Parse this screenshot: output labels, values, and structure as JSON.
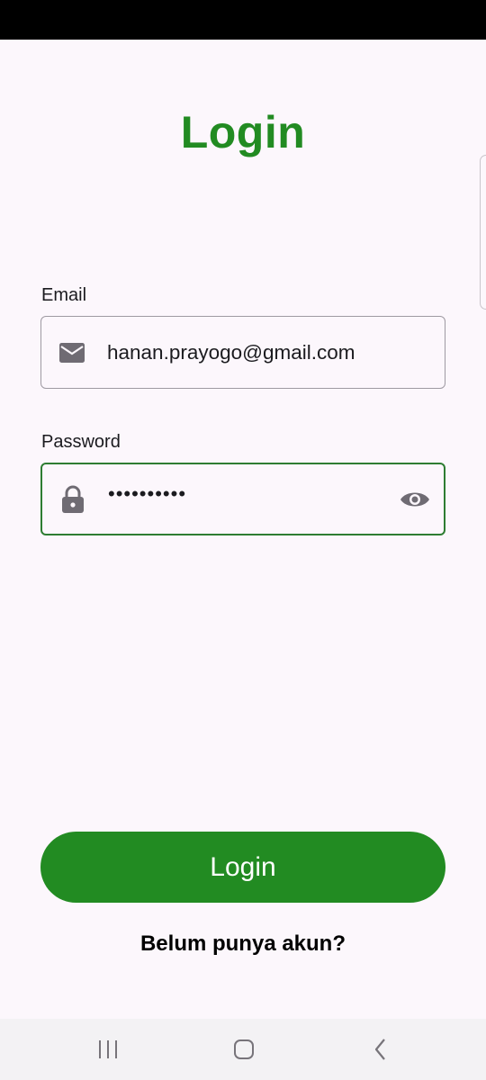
{
  "screen": {
    "title": "Login"
  },
  "email": {
    "label": "Email",
    "value": "hanan.prayogo@gmail.com",
    "icon": "mail-icon"
  },
  "password": {
    "label": "Password",
    "value": "••••••••••",
    "icon": "lock-icon",
    "toggle_icon": "eye-icon"
  },
  "actions": {
    "login_label": "Login",
    "signup_label": "Belum punya akun?"
  },
  "nav": {
    "recents_icon": "recents-icon",
    "home_icon": "home-icon",
    "back_icon": "back-icon"
  },
  "colors": {
    "brand_green": "#228b22",
    "focus_border": "#2e7d32",
    "background": "#fcf7fc",
    "icon_gray": "#6f6b73"
  }
}
